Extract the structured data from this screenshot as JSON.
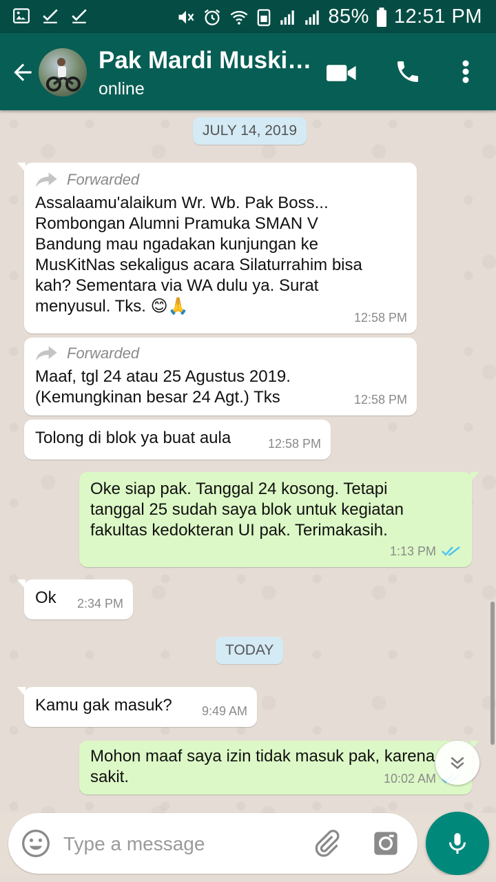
{
  "status_bar": {
    "battery": "85%",
    "time": "12:51 PM",
    "icons": [
      "gallery-icon",
      "check-icon",
      "check-icon",
      "mute-icon",
      "alarm-icon",
      "wifi-icon",
      "data-icon",
      "signal-icon",
      "signal-icon",
      "battery-icon"
    ]
  },
  "header": {
    "title": "Pak Mardi Muski…",
    "status": "online",
    "icons": [
      "back-arrow-icon",
      "video-call-icon",
      "phone-icon",
      "more-vert-icon"
    ]
  },
  "chat": {
    "date_chips": [
      "JULY 14, 2019",
      "TODAY"
    ],
    "messages": [
      {
        "dir": "in",
        "forwarded": true,
        "forwarded_label": "Forwarded",
        "text": "Assalaamu'alaikum Wr. Wb. Pak Boss... Rombongan Alumni Pramuka SMAN V Bandung mau ngadakan kunjungan ke MusKitNas sekaligus acara Silaturrahim bisa kah? Sementara via WA dulu ya. Surat menyusul. Tks. 😊🙏",
        "time": "12:58 PM"
      },
      {
        "dir": "in",
        "forwarded": true,
        "forwarded_label": "Forwarded",
        "text": "Maaf, tgl 24 atau 25 Agustus 2019. (Kemungkinan besar 24 Agt.) Tks",
        "time": "12:58 PM"
      },
      {
        "dir": "in",
        "forwarded": false,
        "text": "Tolong di blok ya buat aula",
        "time": "12:58 PM"
      },
      {
        "dir": "out",
        "text": "Oke siap pak. Tanggal 24 kosong. Tetapi tanggal 25 sudah saya blok untuk kegiatan fakultas kedokteran UI pak. Terimakasih.",
        "time": "1:13 PM",
        "read": true
      },
      {
        "dir": "in",
        "forwarded": false,
        "text": "Ok",
        "time": "2:34 PM"
      },
      {
        "dir": "in",
        "forwarded": false,
        "text": "Kamu gak masuk?",
        "time": "9:49 AM"
      },
      {
        "dir": "out",
        "text": "Mohon maaf saya izin tidak masuk pak, karena sakit.",
        "time": "10:02 AM",
        "read": true
      }
    ]
  },
  "composer": {
    "placeholder": "Type a message",
    "value": "",
    "icons": [
      "emoji-icon",
      "attach-icon",
      "camera-icon",
      "mic-icon"
    ]
  },
  "colors": {
    "status_bar": "#054d44",
    "app_bar": "#075e54",
    "incoming_bubble": "#ffffff",
    "outgoing_bubble": "#dcf8c6",
    "read_ticks": "#4fc3f7",
    "mic_button": "#00897b",
    "date_chip": "#d4eaf4"
  }
}
